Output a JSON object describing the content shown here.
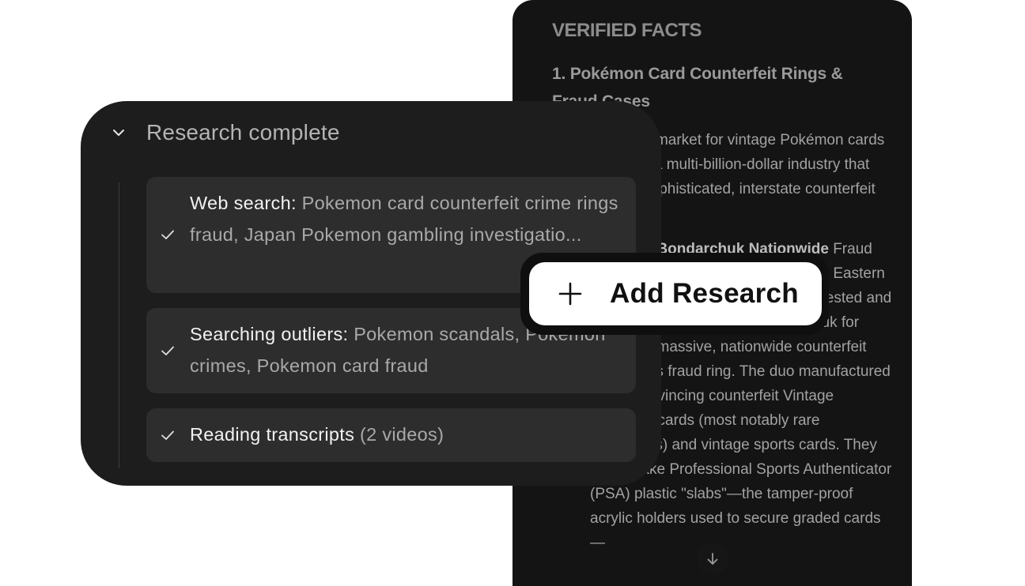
{
  "document": {
    "heading": "VERIFIED FACTS",
    "subheading": "1. Pokémon Card Counterfeit Rings & Fraud Cases",
    "intro": "The secondary market for vintage Pokémon cards has grown into a multi-billion-dollar industry that has attracted sophisticated, interstate counterfeit networks:",
    "item_title": "Curcio & Bondarchuk Nationwide",
    "item_body": "Fraud Ring: In 2024, Federal agents in the Eastern District of Pennsylvania (USAO) arrested and charged Curcio and Iosif Bondarchuk for running a massive, nationwide counterfeit collectibles fraud ring. The duo manufactured highly convincing counterfeit Vintage Pokémon cards (most notably rare Charizards) and vintage sports cards. They forged fake Professional Sports Authenticator (PSA) plastic \"slabs\"—the tamper-proof acrylic holders used to secure graded cards—"
  },
  "research": {
    "title": "Research complete",
    "steps": [
      {
        "label": "Web search:",
        "value": "Pokemon card counterfeit crime rings fraud, Japan Pokemon gambling investigatio..."
      },
      {
        "label": "Searching outliers:",
        "value": "Pokemon scandals, Pokemon crimes, Pokemon card fraud"
      },
      {
        "label": "Reading transcripts",
        "value": "(2 videos)"
      }
    ]
  },
  "add_button": {
    "label": "Add Research"
  },
  "colors": {
    "panel": "#1d1d1d",
    "card": "#2d2d2d",
    "doc": "#141414",
    "button": "#ffffff"
  },
  "icons": [
    "chevron-down-icon",
    "check-icon",
    "plus-icon",
    "arrow-down-icon"
  ]
}
